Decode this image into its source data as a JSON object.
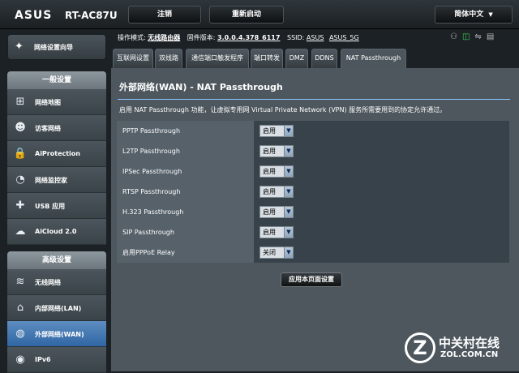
{
  "header": {
    "brand": "ASUS",
    "model": "RT-AC87U",
    "logout": "注销",
    "reboot": "重新启动",
    "language": "简体中文"
  },
  "status": {
    "mode_label": "操作模式:",
    "mode": "无线路由器",
    "fw_label": "固件版本:",
    "fw": "3.0.0.4.378_6117",
    "ssid_label": "SSID:",
    "ssid1": "ASUS",
    "ssid2": "ASUS_5G"
  },
  "sidebar": {
    "wizard": "网络设置向导",
    "general_title": "一般设置",
    "general": [
      {
        "label": "网络地图",
        "icon": "network-map-icon"
      },
      {
        "label": "访客网络",
        "icon": "guest-network-icon"
      },
      {
        "label": "AiProtection",
        "icon": "lock-icon"
      },
      {
        "label": "网络监控家",
        "icon": "gauge-icon"
      },
      {
        "label": "USB 应用",
        "icon": "puzzle-icon"
      },
      {
        "label": "AiCloud 2.0",
        "icon": "cloud-icon"
      }
    ],
    "advanced_title": "高级设置",
    "advanced": [
      {
        "label": "无线网络",
        "icon": "wifi-icon"
      },
      {
        "label": "内部网络(LAN)",
        "icon": "home-icon"
      },
      {
        "label": "外部网络(WAN)",
        "icon": "globe-icon"
      },
      {
        "label": "IPv6",
        "icon": "ipv6-globe-icon"
      }
    ]
  },
  "tabs": [
    "互联网设置",
    "双线路",
    "通信端口触发程序",
    "端口转发",
    "DMZ",
    "DDNS",
    "NAT Passthrough"
  ],
  "page": {
    "title": "外部网络(WAN) - NAT Passthrough",
    "description": "启用 NAT Passthrough 功能，让虚拟专用网 Virtual Private Network (VPN) 服务所需要用到的协定允许通过。",
    "apply": "应用本页面设置"
  },
  "settings": [
    {
      "label": "PPTP Passthrough",
      "value": "启用"
    },
    {
      "label": "L2TP Passthrough",
      "value": "启用"
    },
    {
      "label": "IPSec Passthrough",
      "value": "启用"
    },
    {
      "label": "RTSP Passthrough",
      "value": "启用"
    },
    {
      "label": "H.323 Passthrough",
      "value": "启用"
    },
    {
      "label": "SIP Passthrough",
      "value": "启用"
    },
    {
      "label": "启用PPPoE Relay",
      "value": "关闭"
    }
  ],
  "watermark": {
    "title": "中关村在线",
    "url": "ZOL.COM.CN"
  }
}
